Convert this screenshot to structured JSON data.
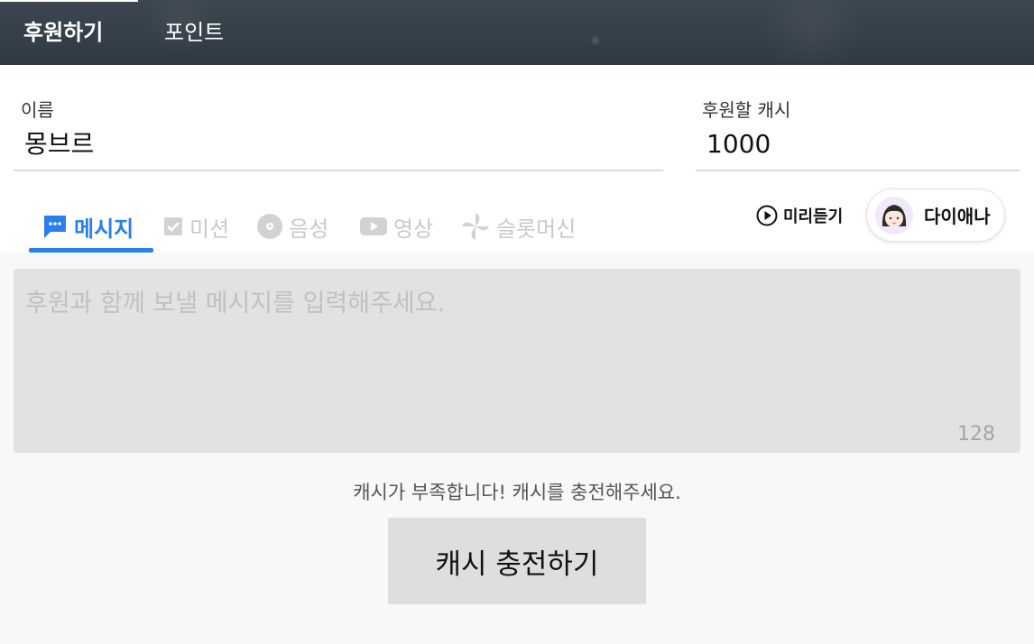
{
  "header": {
    "tabs": [
      {
        "label": "후원하기",
        "active": true
      },
      {
        "label": "포인트",
        "active": false
      }
    ]
  },
  "form": {
    "name_label": "이름",
    "name_value": "몽브르",
    "cash_label": "후원할 캐시",
    "cash_value": "1000"
  },
  "type_tabs": [
    {
      "label": "메시지",
      "icon": "chat-bubble-icon",
      "active": true
    },
    {
      "label": "미션",
      "icon": "checkbox-icon",
      "active": false
    },
    {
      "label": "음성",
      "icon": "record-disc-icon",
      "active": false
    },
    {
      "label": "영상",
      "icon": "play-video-icon",
      "active": false
    },
    {
      "label": "슬롯머신",
      "icon": "pinwheel-icon",
      "active": false
    }
  ],
  "voice": {
    "preview_label": "미리듣기",
    "voice_name": "다이애나"
  },
  "message": {
    "placeholder": "후원과 함께 보낼 메시지를 입력해주세요.",
    "char_limit": "128"
  },
  "notice": "캐시가 부족합니다! 캐시를 충전해주세요.",
  "charge_button": "캐시 충전하기",
  "colors": {
    "accent": "#2a7ff0",
    "header_bg": "#3a444e",
    "input_bg": "#e2e2e2"
  }
}
